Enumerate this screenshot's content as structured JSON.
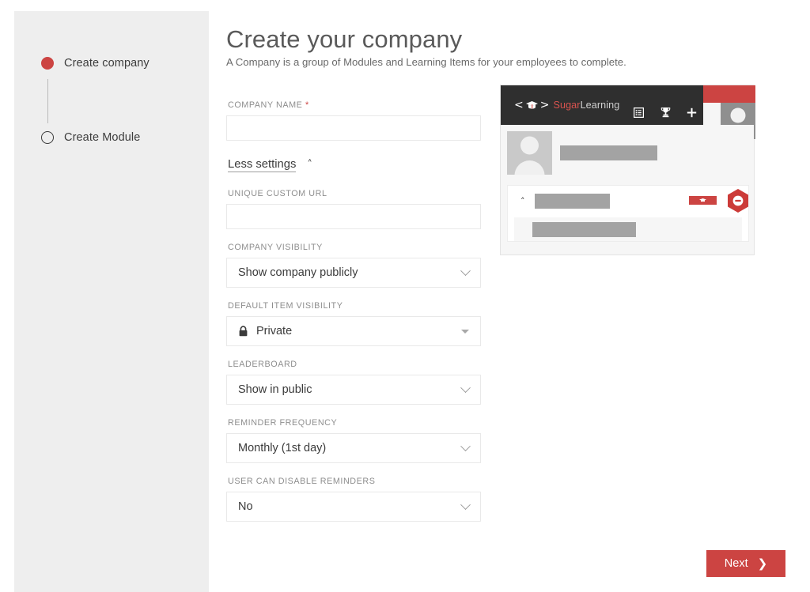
{
  "wizard": {
    "steps": [
      {
        "label": "Create company",
        "state": "active"
      },
      {
        "label": "Create Module",
        "state": "pending"
      }
    ]
  },
  "header": {
    "title": "Create your company",
    "subtitle": "A Company is a group of Modules and Learning Items for your employees to complete."
  },
  "form": {
    "company_name": {
      "label": "COMPANY NAME",
      "required_mark": "*",
      "value": "",
      "placeholder": ""
    },
    "toggle_settings": {
      "label": "Less settings",
      "caret": "˄",
      "icon": "chevron-up-icon"
    },
    "unique_custom_url": {
      "label": "UNIQUE CUSTOM URL",
      "value": "",
      "placeholder": ""
    },
    "company_visibility": {
      "label": "COMPANY VISIBILITY",
      "value": "Show company publicly"
    },
    "default_item_visibility": {
      "label": "DEFAULT ITEM VISIBILITY",
      "value": "Private",
      "icon": "lock-icon"
    },
    "leaderboard": {
      "label": "LEADERBOARD",
      "value": "Show in public"
    },
    "reminder_frequency": {
      "label": "REMINDER FREQUENCY",
      "value": "Monthly (1st day)"
    },
    "user_can_disable_reminders": {
      "label": "USER CAN DISABLE REMINDERS",
      "value": "No"
    }
  },
  "preview": {
    "logo": {
      "bracket_left": "<",
      "bracket_right": ">",
      "cap_icon": "graduation-cap-icon",
      "brand_first": "Sugar",
      "brand_second": "Learning"
    },
    "toolbar_icons": [
      "list-icon",
      "trophy-icon",
      "plus-icon"
    ],
    "avatar_icon": "user-avatar-icon",
    "placeholder_blocks": [
      "user-name-bar",
      "item-title-bar",
      "sub-item-bar"
    ],
    "badges": [
      "red-pill-badge",
      "red-hexagon-block-icon"
    ],
    "collapse_caret": "˄"
  },
  "footer": {
    "next_label": "Next",
    "next_caret": "❯"
  },
  "colors": {
    "accent_red": "#cc4442",
    "brand_red": "#d9534f",
    "dark_bar": "#2f2f2f",
    "sidebar_gray": "#eeeeee",
    "label_gray": "#8e8e8e",
    "title_gray": "#5a5a5a",
    "placeholder_gray": "#a3a3a3"
  }
}
